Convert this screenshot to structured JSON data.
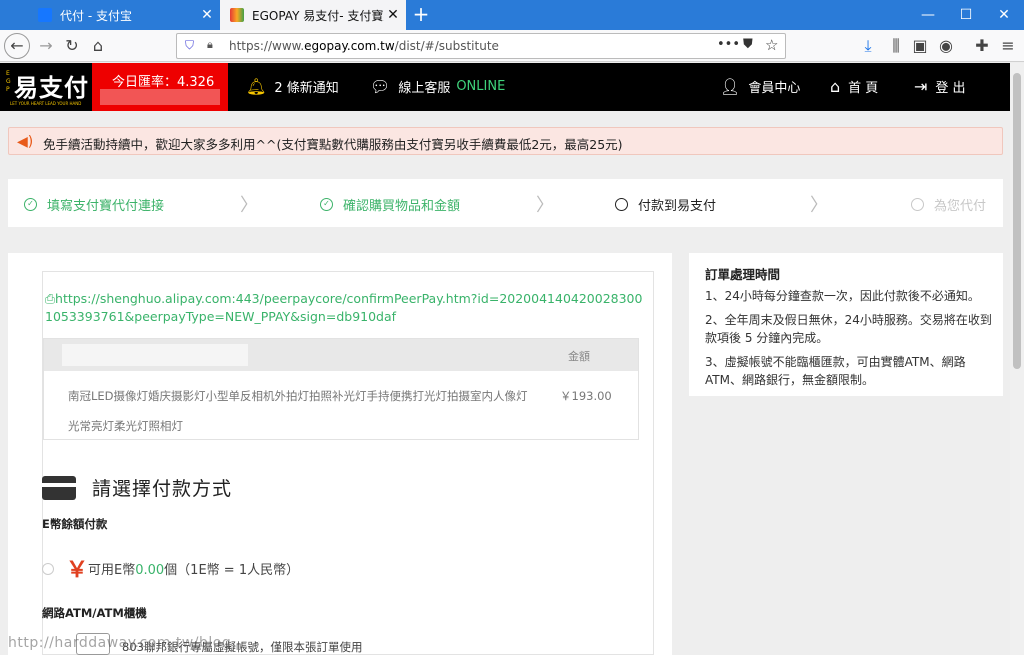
{
  "browser": {
    "tabs": [
      {
        "title": "代付 - 支付宝",
        "favicon_color": "#1677ff"
      },
      {
        "title": "EGOPAY 易支付- 支付寶點數代",
        "favicon_color": "#e8a000"
      }
    ],
    "url_prefix": "https://www.",
    "url_domain": "egopay.com.tw",
    "url_path": "/dist/#/substitute",
    "icons": [
      "back-icon",
      "forward-icon",
      "reload-icon",
      "home-icon",
      "shield-icon",
      "lock-icon",
      "more-icon",
      "pocket-icon",
      "star-icon",
      "download-icon",
      "library-icon",
      "sidebar-icon",
      "account-icon",
      "extensions-icon",
      "menu-icon"
    ]
  },
  "header": {
    "logo_text": "易支付",
    "logo_side": "EGP",
    "logo_tagline": "LET YOUR HEART LEAD YOUR HAND",
    "rate_label": "今日匯率：4.326",
    "notifications": "2 條新通知",
    "service_label": "線上客服",
    "service_status": "ONLINE",
    "member": "會員中心",
    "home": "首 頁",
    "logout": "登 出"
  },
  "notice": {
    "text": "免手續活動持續中，歡迎大家多多利用^^(支付寶點數代購服務由支付寶另收手續費最低2元，最高25元)"
  },
  "steps": [
    {
      "label": "填寫支付寶代付連接",
      "status": "done"
    },
    {
      "label": "確認購買物品和金額",
      "status": "done"
    },
    {
      "label": "付款到易支付",
      "status": "current"
    },
    {
      "label": "為您代付",
      "status": "todo"
    }
  ],
  "order": {
    "link": "https://shenghuo.alipay.com:443/peerpaycore/confirmPeerPay.htm?id=2020041404200283001053393761&peerpayType=NEW_PPAY&sign=db910daf",
    "amount_header": "金額",
    "product_name": "南冠LED摄像灯婚庆摄影灯小型单反相机外拍灯拍照补光灯手持便携打光灯拍摄室内人像灯光常亮灯柔光灯照相灯",
    "product_price": "￥193.00"
  },
  "payment": {
    "title": "請選擇付款方式",
    "ecoin_title": "E幣餘額付款",
    "ecoin_symbol": "￥",
    "ecoin_prefix": "可用E幣",
    "ecoin_count": "0.00",
    "ecoin_suffix": "個（1E幣 = 1人民幣）",
    "atm_title": "網路ATM/ATM櫃機",
    "atm_desc": "803聯邦銀行專屬虛擬帳號，僅限本張訂單使用"
  },
  "side": {
    "title": "訂單處理時間",
    "items": [
      "1、24小時每分鐘查款一次，因此付款後不必通知。",
      "2、全年周末及假日無休，24小時服務。交易將在收到款項後 5 分鐘內完成。",
      "3、虛擬帳號不能臨櫃匯款，可由實體ATM、網路ATM、網路銀行，無金額限制。"
    ]
  },
  "watermark": "http://harddaway.com.tw/blog"
}
